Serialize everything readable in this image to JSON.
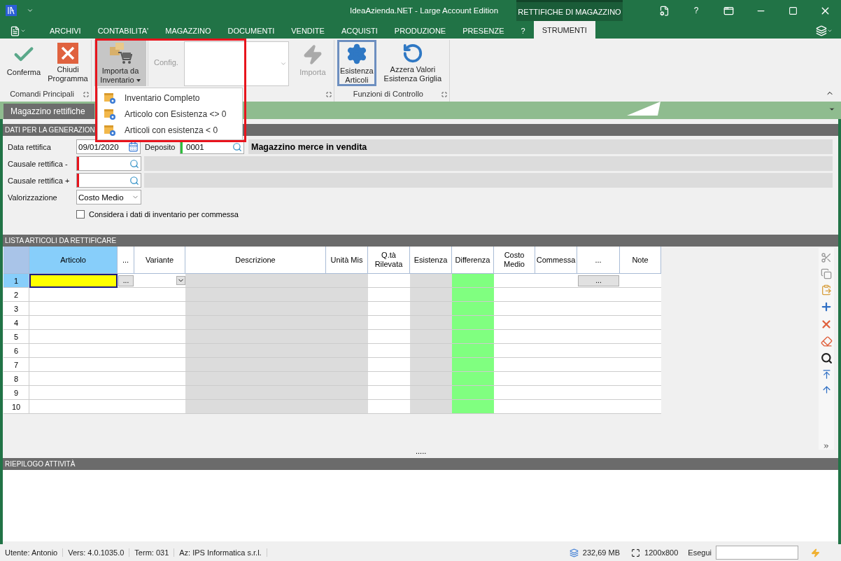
{
  "window": {
    "title": "IdeaAzienda.NET - Large Account Edition",
    "context_tab": "RETTIFICHE DI MAGAZZINO",
    "help": "?"
  },
  "menu_tabs": [
    {
      "label": "ARCHIVI",
      "selected": false
    },
    {
      "label": "CONTABILITA'",
      "selected": false
    },
    {
      "label": "MAGAZZINO",
      "selected": false
    },
    {
      "label": "DOCUMENTI",
      "selected": false
    },
    {
      "label": "VENDITE",
      "selected": false
    },
    {
      "label": "ACQUISTI",
      "selected": false
    },
    {
      "label": "PRODUZIONE",
      "selected": false
    },
    {
      "label": "PRESENZE",
      "selected": false
    },
    {
      "label": "?",
      "selected": false
    },
    {
      "label": "STRUMENTI",
      "selected": true
    }
  ],
  "ribbon": {
    "groups": [
      {
        "label": "Comandi Principali",
        "items": [
          {
            "kind": "confirm",
            "label": "Conferma",
            "selected": false,
            "disabled": false
          },
          {
            "kind": "close",
            "label": "Chiudi Programma",
            "selected": false,
            "disabled": false
          }
        ]
      },
      {
        "items": [
          {
            "kind": "import-menu",
            "label": "Importa da Inventario",
            "selected": true,
            "disabled": false
          },
          {
            "kind": "combo",
            "label": "Config.",
            "disabled": true
          },
          {
            "kind": "run",
            "label": "Importa",
            "selected": false,
            "disabled": true
          }
        ]
      },
      {
        "label": "Funzioni di Controllo",
        "items": [
          {
            "kind": "gear",
            "label": "Esistenza Articoli",
            "selected": true,
            "disabled": false
          },
          {
            "kind": "reset",
            "label": "Azzera Valori Esistenza Griglia",
            "selected": false,
            "disabled": false
          }
        ]
      }
    ]
  },
  "dropdown_menu": [
    "Inventario Completo",
    "Articolo con Esistenza <> 0",
    "Articoli con esistenza < 0"
  ],
  "document_tab": "Magazzino rettifiche",
  "form": {
    "header": "DATI PER LA GENERAZION",
    "date": {
      "label": "Data rettifica",
      "value": "09/01/2020"
    },
    "deposit": {
      "label": "Deposito",
      "value": "0001",
      "color": "#2dbe3c",
      "description": "Magazzino merce in vendita"
    },
    "lookups": [
      {
        "label": "Causale rettifica -",
        "color": "#e8141d"
      },
      {
        "label": "Causale rettifica +",
        "color": "#e8141d"
      }
    ],
    "valuation": {
      "label": "Valorizzazione",
      "value": "Costo Medio"
    },
    "option": {
      "label": "Considera i dati di inventario per commessa",
      "checked": false
    }
  },
  "grid": {
    "header": "LISTA ARTICOLI DA RETTIFICARE",
    "columns": [
      {
        "label": "Articolo",
        "kind": "key",
        "selected": true
      },
      {
        "label": "...",
        "kind": "button",
        "selected": false
      },
      {
        "label": "Variante",
        "kind": "combo",
        "selected": false
      },
      {
        "label": "Descrizione",
        "kind": "readonly",
        "selected": false
      },
      {
        "label": "Unità Mis",
        "kind": "readonly",
        "selected": false
      },
      {
        "label": "Q.tà Rilevata",
        "kind": "input",
        "selected": false
      },
      {
        "label": "Esistenza",
        "kind": "readonly",
        "selected": false
      },
      {
        "label": "Differenza",
        "kind": "diff",
        "selected": false
      },
      {
        "label": "Costo Medio",
        "kind": "input",
        "selected": false
      },
      {
        "label": "Commessa",
        "kind": "input",
        "selected": false
      },
      {
        "label": "...",
        "kind": "button",
        "selected": false
      },
      {
        "label": "Note",
        "kind": "input",
        "selected": false
      }
    ],
    "rows": [
      {
        "number": "1",
        "selected": true
      },
      {
        "number": "2",
        "selected": false
      },
      {
        "number": "3",
        "selected": false
      },
      {
        "number": "4",
        "selected": false
      },
      {
        "number": "5",
        "selected": false
      },
      {
        "number": "6",
        "selected": false
      },
      {
        "number": "7",
        "selected": false
      },
      {
        "number": "8",
        "selected": false
      },
      {
        "number": "9",
        "selected": false
      },
      {
        "number": "10",
        "selected": false
      }
    ],
    "cell_button": "...",
    "splitter": "....."
  },
  "activity": {
    "header": "RIEPILOGO ATTIVITÀ"
  },
  "status_bar": {
    "items": [
      "Utente: Antonio",
      "Vers: 4.0.1035.0",
      "Term: 031",
      "Az: IPS Informatica s.r.l."
    ],
    "memory": "232,69 MB",
    "resolution": "1200x800",
    "run_label": "Esegui"
  }
}
